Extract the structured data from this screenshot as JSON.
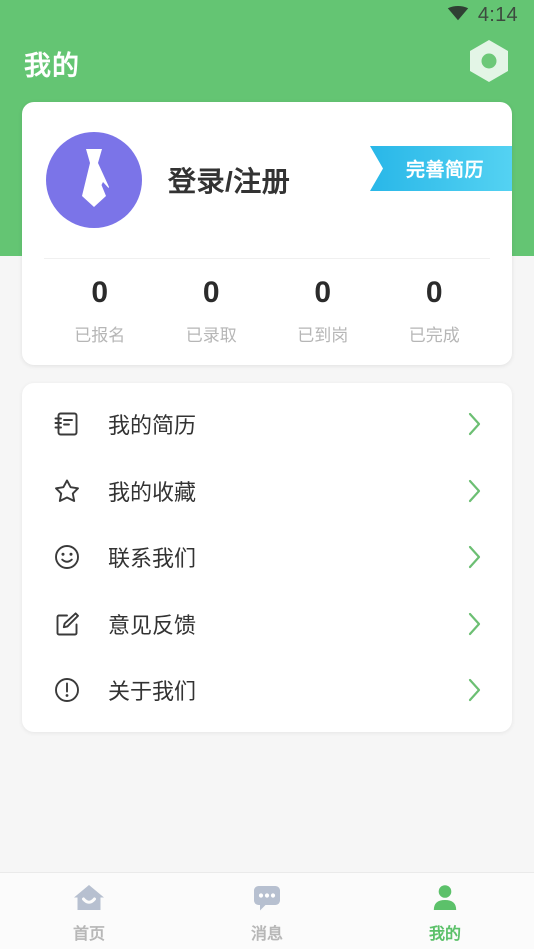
{
  "status_bar": {
    "time": "4:14",
    "wifi_icon": "wifi-icon"
  },
  "app_bar": {
    "title": "我的",
    "settings_icon": "hexagon-settings-icon"
  },
  "profile": {
    "avatar_icon": "necktie-avatar-icon",
    "login_label": "登录/注册",
    "ribbon_label": "完善简历",
    "stats": [
      {
        "value": "0",
        "label": "已报名"
      },
      {
        "value": "0",
        "label": "已录取"
      },
      {
        "value": "0",
        "label": "已到岗"
      },
      {
        "value": "0",
        "label": "已完成"
      }
    ]
  },
  "menu": {
    "items": [
      {
        "label": "我的简历",
        "icon": "notebook-icon"
      },
      {
        "label": "我的收藏",
        "icon": "star-icon"
      },
      {
        "label": "联系我们",
        "icon": "smiley-icon"
      },
      {
        "label": "意见反馈",
        "icon": "edit-square-icon"
      },
      {
        "label": "关于我们",
        "icon": "exclamation-circle-icon"
      }
    ],
    "chevron_icon": "chevron-right-icon"
  },
  "bottom_nav": {
    "items": [
      {
        "label": "首页",
        "icon": "home-icon",
        "active": false
      },
      {
        "label": "消息",
        "icon": "message-bubble-icon",
        "active": false
      },
      {
        "label": "我的",
        "icon": "person-icon",
        "active": true
      }
    ]
  },
  "colors": {
    "brand_green": "#64c573",
    "active_green": "#5cc16a",
    "avatar_purple": "#7b74e8",
    "ribbon_blue": "#29b7e8",
    "page_bg": "#f6f6f6",
    "nav_inactive": "#b7c0d0"
  }
}
